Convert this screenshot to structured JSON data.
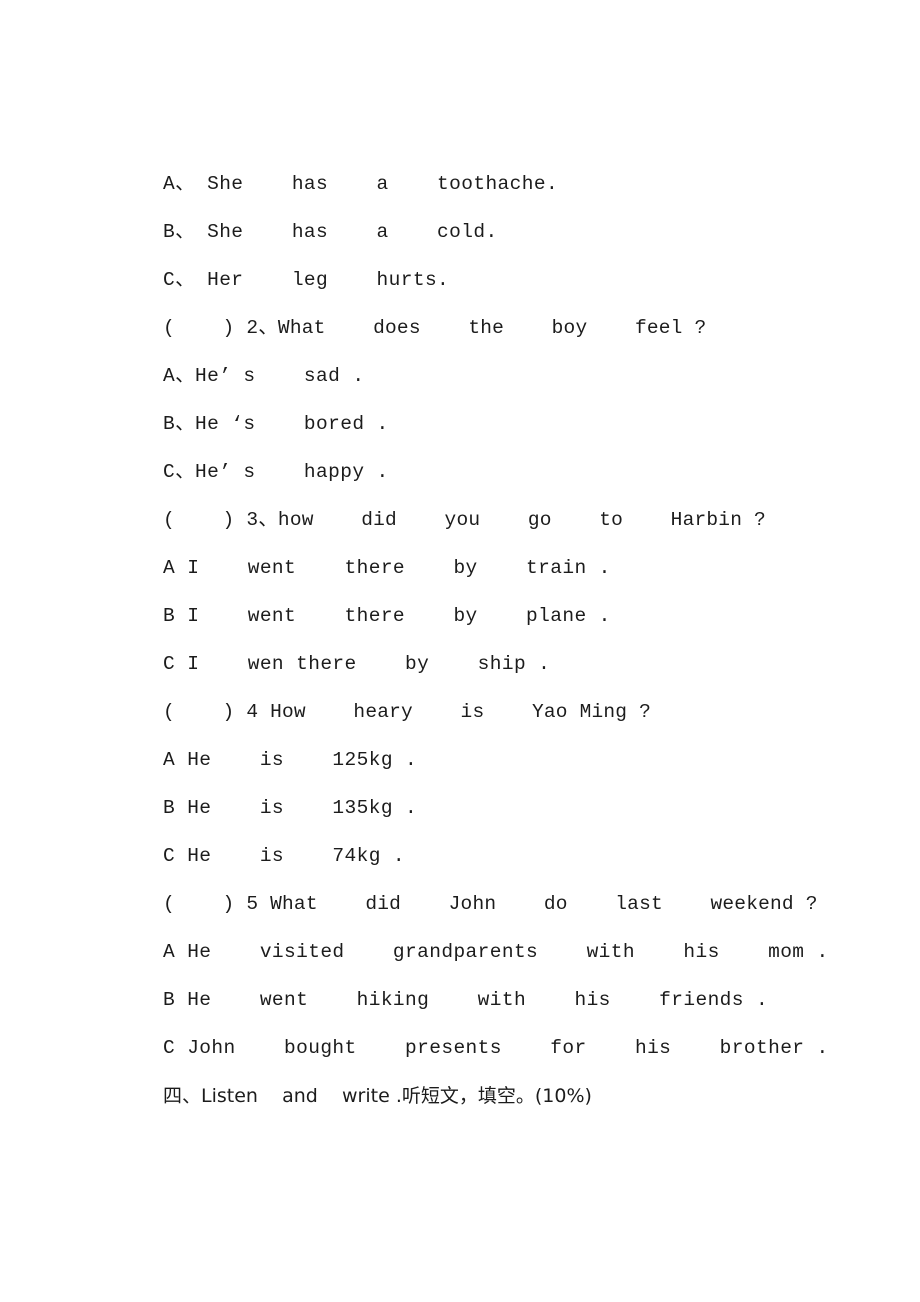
{
  "document": {
    "background_color": "#ffffff",
    "text_color": "#1c1c1c",
    "lines": [
      {
        "id": "opt-1a",
        "kind": "option",
        "text": "A、 She    has    a    toothache."
      },
      {
        "id": "opt-1b",
        "kind": "option",
        "text": "B、 She    has    a    cold."
      },
      {
        "id": "opt-1c",
        "kind": "option",
        "text": "C、 Her    leg    hurts."
      },
      {
        "id": "q-2",
        "kind": "stem",
        "text": "(    ) 2、What    does    the    boy    feel ?"
      },
      {
        "id": "opt-2a",
        "kind": "option",
        "text": "A、He’ s    sad ."
      },
      {
        "id": "opt-2b",
        "kind": "option",
        "text": "B、He ‘s    bored ."
      },
      {
        "id": "opt-2c",
        "kind": "option",
        "text": "C、He’ s    happy ."
      },
      {
        "id": "q-3",
        "kind": "stem",
        "text": "(    ) 3、how    did    you    go    to    Harbin ?"
      },
      {
        "id": "opt-3a",
        "kind": "option",
        "text": "A I    went    there    by    train ."
      },
      {
        "id": "opt-3b",
        "kind": "option",
        "text": "B I    went    there    by    plane ."
      },
      {
        "id": "opt-3c",
        "kind": "option",
        "text": "C I    wen there    by    ship ."
      },
      {
        "id": "q-4",
        "kind": "stem",
        "text": "(    ) 4 How    heary    is    Yao Ming ?"
      },
      {
        "id": "opt-4a",
        "kind": "option",
        "text": "A He    is    125kg ."
      },
      {
        "id": "opt-4b",
        "kind": "option",
        "text": "B He    is    135kg ."
      },
      {
        "id": "opt-4c",
        "kind": "option",
        "text": "C He    is    74kg ."
      },
      {
        "id": "q-5",
        "kind": "stem",
        "text": "(    ) 5 What    did    John    do    last    weekend ?"
      },
      {
        "id": "opt-5a",
        "kind": "option",
        "text": "A He    visited    grandparents    with    his    mom ."
      },
      {
        "id": "opt-5b",
        "kind": "option",
        "text": "B He    went    hiking    with    his    friends ."
      },
      {
        "id": "opt-5c",
        "kind": "option",
        "text": "C John    bought    presents    for    his    brother ."
      },
      {
        "id": "section-4",
        "kind": "heading-cjk",
        "text": "四、Listen    and    write .听短文，填空。(10%)"
      }
    ]
  }
}
